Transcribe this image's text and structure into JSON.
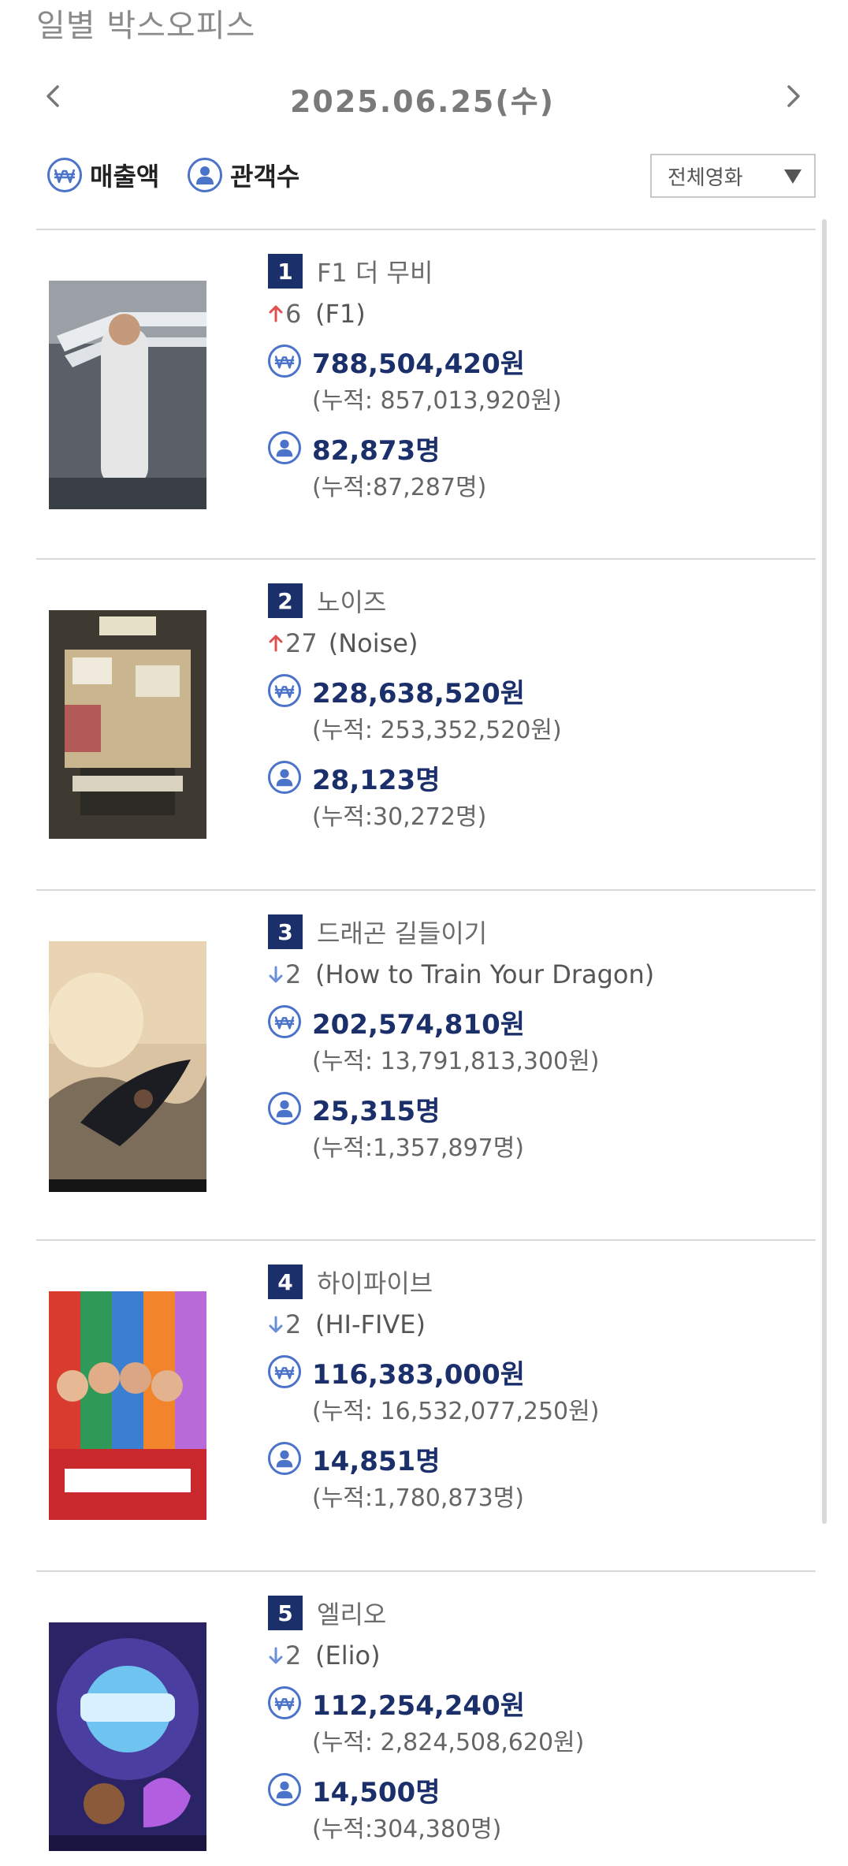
{
  "page_title": "일별 박스오피스",
  "date_nav": {
    "date": "2025.06.25(수)",
    "prev_icon": "chevron-left-icon",
    "next_icon": "chevron-right-icon"
  },
  "filters": {
    "revenue_label": "매출액",
    "audience_label": "관객수",
    "revenue_icon": "won-icon",
    "audience_icon": "person-icon",
    "dropdown_value": "전체영화"
  },
  "colors": {
    "accent": "#4b73c9",
    "badge": "#1b2f6b",
    "up": "#e05050",
    "down": "#6a8fd6"
  },
  "movies": [
    {
      "rank": "1",
      "title_kr": "F1 더 무비",
      "change_dir": "up",
      "change": "6",
      "title_en": "(F1)",
      "revenue": "788,504,420원",
      "revenue_cum": "(누적: 857,013,920원)",
      "audience": "82,873명",
      "audience_cum": "(누적:87,287명)"
    },
    {
      "rank": "2",
      "title_kr": "노이즈",
      "change_dir": "up",
      "change": "27",
      "title_en": "(Noise)",
      "revenue": "228,638,520원",
      "revenue_cum": "(누적: 253,352,520원)",
      "audience": "28,123명",
      "audience_cum": "(누적:30,272명)"
    },
    {
      "rank": "3",
      "title_kr": "드래곤 길들이기",
      "change_dir": "down",
      "change": "2",
      "title_en": "(How to Train Your Dragon)",
      "revenue": "202,574,810원",
      "revenue_cum": "(누적: 13,791,813,300원)",
      "audience": "25,315명",
      "audience_cum": "(누적:1,357,897명)"
    },
    {
      "rank": "4",
      "title_kr": "하이파이브",
      "change_dir": "down",
      "change": "2",
      "title_en": "(HI-FIVE)",
      "revenue": "116,383,000원",
      "revenue_cum": "(누적: 16,532,077,250원)",
      "audience": "14,851명",
      "audience_cum": "(누적:1,780,873명)"
    },
    {
      "rank": "5",
      "title_kr": "엘리오",
      "change_dir": "down",
      "change": "2",
      "title_en": "(Elio)",
      "revenue": "112,254,240원",
      "revenue_cum": "(누적: 2,824,508,620원)",
      "audience": "14,500명",
      "audience_cum": "(누적:304,380명)"
    }
  ]
}
